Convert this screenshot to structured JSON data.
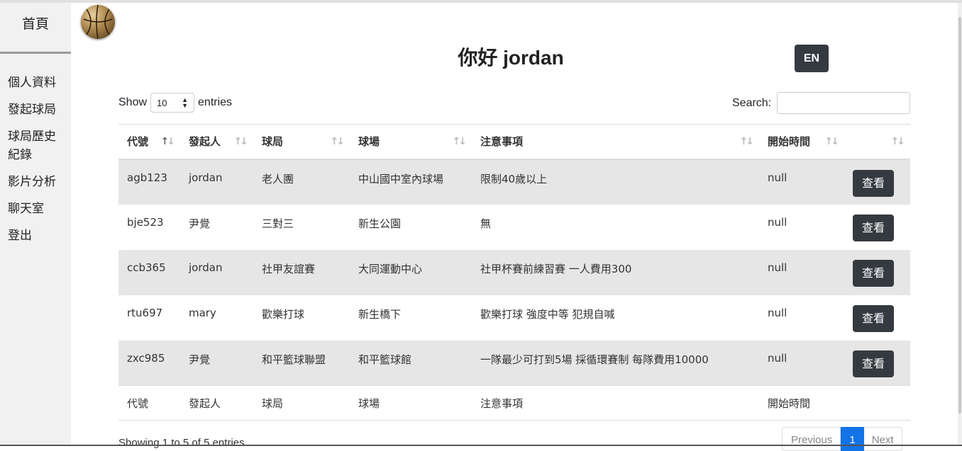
{
  "sidebar": {
    "home": "首頁",
    "items": [
      {
        "label": "個人資料"
      },
      {
        "label": "發起球局"
      },
      {
        "label": "球局歷史紀錄"
      },
      {
        "label": "影片分析"
      },
      {
        "label": "聊天室"
      },
      {
        "label": "登出"
      }
    ]
  },
  "header": {
    "greeting": "你好 jordan",
    "lang_button": "EN"
  },
  "controls": {
    "show_label": "Show",
    "entries_value": "10",
    "entries_label": "entries",
    "search_label": "Search:"
  },
  "table": {
    "columns": [
      "代號",
      "發起人",
      "球局",
      "球場",
      "注意事項",
      "開始時間",
      ""
    ],
    "rows": [
      {
        "code": "agb123",
        "host": "jordan",
        "game": "老人團",
        "court": "中山國中室內球場",
        "notes": "限制40歲以上",
        "start": "null",
        "action": "查看"
      },
      {
        "code": "bje523",
        "host": "尹覺",
        "game": "三對三",
        "court": "新生公園",
        "notes": "無",
        "start": "null",
        "action": "查看"
      },
      {
        "code": "ccb365",
        "host": "jordan",
        "game": "社甲友誼賽",
        "court": "大同運動中心",
        "notes": "社甲杯賽前練習賽 一人費用300",
        "start": "null",
        "action": "查看"
      },
      {
        "code": "rtu697",
        "host": "mary",
        "game": "歡樂打球",
        "court": "新生橋下",
        "notes": "歡樂打球 強度中等 犯規自喊",
        "start": "null",
        "action": "查看"
      },
      {
        "code": "zxc985",
        "host": "尹覺",
        "game": "和平籃球聯盟",
        "court": "和平籃球館",
        "notes": "一隊最少可打到5場 採循環賽制 每隊費用10000",
        "start": "null",
        "action": "查看"
      }
    ]
  },
  "footer": {
    "info": "Showing 1 to 5 of 5 entries",
    "previous": "Previous",
    "page": "1",
    "next": "Next"
  }
}
